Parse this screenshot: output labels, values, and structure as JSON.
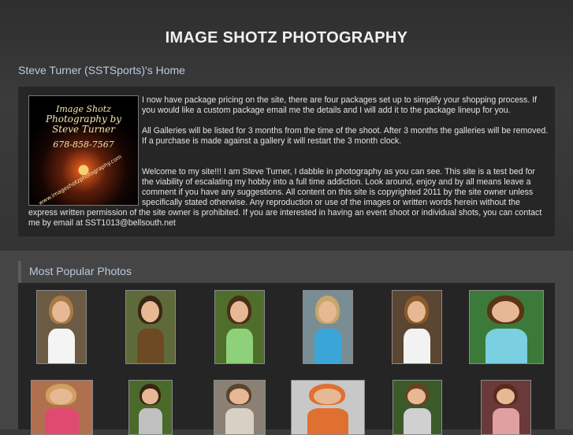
{
  "site": {
    "title": "IMAGE SHOTZ PHOTOGRAPHY",
    "home_heading": "Steve Turner (SSTSports)'s Home"
  },
  "intro": {
    "logo": {
      "line1": "Image Shotz",
      "line2": "Photography by Steve Turner",
      "phone": "678-858-7567",
      "url": "www.imageshotzphotography.com"
    },
    "paragraph1": "I now have package pricing on the site, there are four packages set up to simplify your shopping process. If you would like a custom package email me the details and I will add it to the package lineup for you.",
    "paragraph2": "All Galleries will be listed for 3 months from the time of the shoot. After 3 months the galleries will be removed. If a purchase is made against a gallery it will restart the 3 month clock.",
    "paragraph3": "Welcome to my site!!! I am Steve Turner, I dabble in photography as you can see. This site is a test bed for the viability of escalating my hobby into a full time addiction. Look around, enjoy and by all means leave a comment if you have any suggestions. All content on this site is copyrighted 2011 by the site owner unless specifically stated otherwise. Any reproduction or use of the images or written words herein without the express written permission of the site owner is prohibited. If you are interested in having an event shoot or individual shots, you can contact me by email at SST1013@bellsouth.net"
  },
  "popular": {
    "heading": "Most Popular Photos",
    "photos": [
      {
        "bg": "#6b5a44",
        "hair": "#a67a45",
        "shirt": "#f4f4f4"
      },
      {
        "bg": "#5e6a3a",
        "hair": "#3a2616",
        "shirt": "#6e4a24"
      },
      {
        "bg": "#4f6e2c",
        "hair": "#4a2e18",
        "shirt": "#8fd07a"
      },
      {
        "bg": "#7a8c94",
        "hair": "#c9a66a",
        "shirt": "#3aa6d8"
      },
      {
        "bg": "#5a4632",
        "hair": "#8a5a2a",
        "shirt": "#f2f2f2"
      },
      {
        "bg": "#3c7a3a",
        "hair": "#5a3416",
        "shirt": "#7ad0e0"
      },
      {
        "bg": "#b07050",
        "hair": "#d0a060",
        "shirt": "#e04a70"
      },
      {
        "bg": "#4a6a2a",
        "hair": "#3a2414",
        "shirt": "#c0c0c0"
      },
      {
        "bg": "#8a8074",
        "hair": "#5a4430",
        "shirt": "#d8d0c4"
      },
      {
        "bg": "#c8c8c8",
        "hair": "#e07030",
        "shirt": "#e07030"
      },
      {
        "bg": "#3a5a2a",
        "hair": "#6a4020",
        "shirt": "#d0d0d0"
      },
      {
        "bg": "#6a3a3a",
        "hair": "#5a2a1a",
        "shirt": "#e0a0a0"
      }
    ]
  }
}
